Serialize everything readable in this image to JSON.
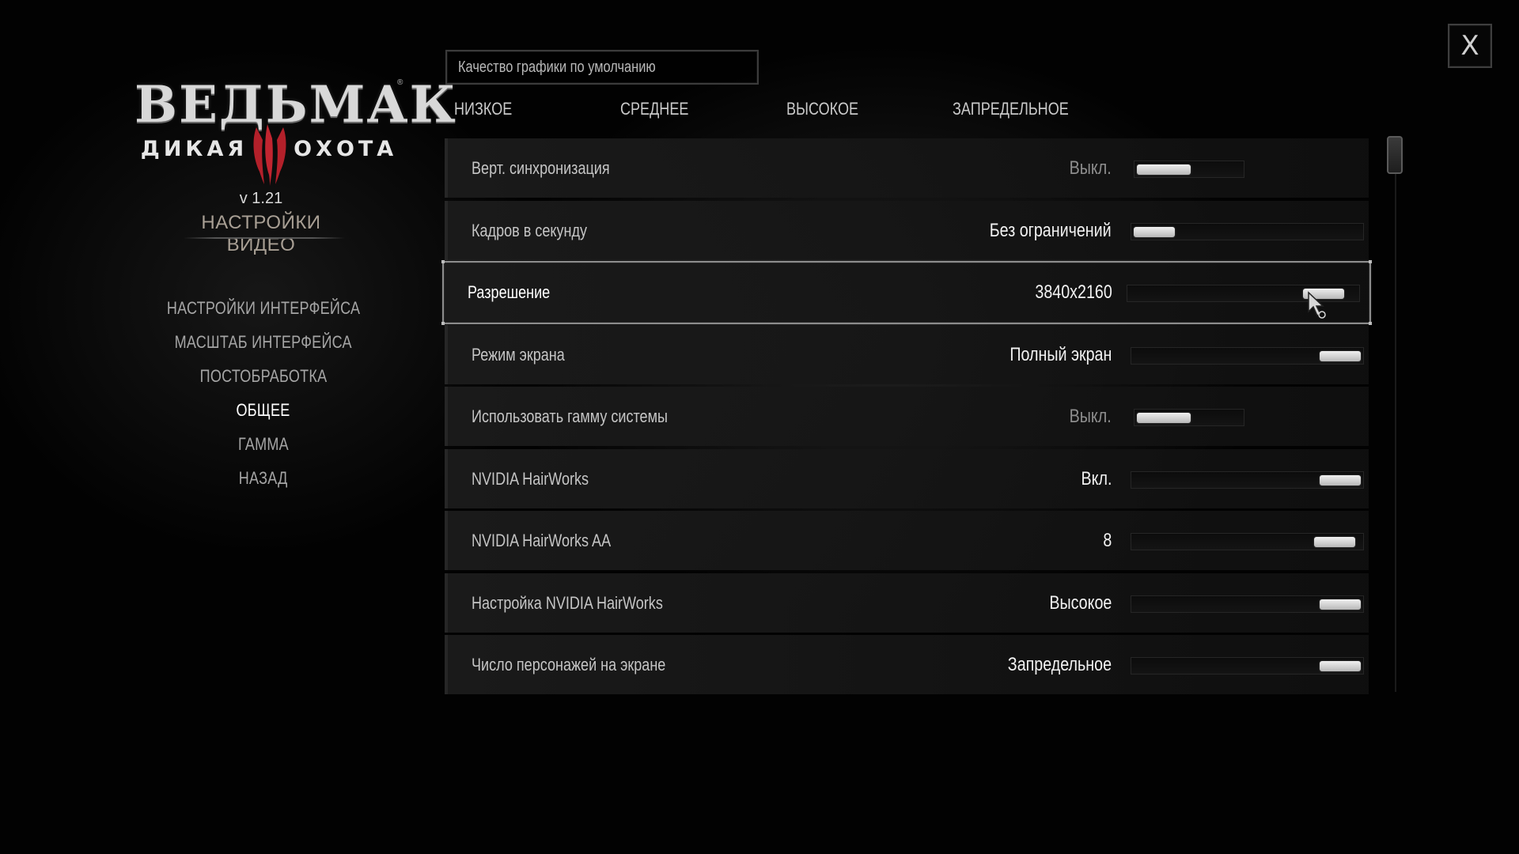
{
  "logo": {
    "title": "ВЕДЬМАК",
    "subtitle_left": "ДИКАЯ",
    "subtitle_right": "ОХОТА",
    "registered_mark": "®",
    "emblem_icon": "wolf-claw-III-icon"
  },
  "version": "v 1.21",
  "section_title": "НАСТРОЙКИ ВИДЕО",
  "menu": {
    "items": [
      {
        "label": "НАСТРОЙКИ ИНТЕРФЕЙСА",
        "active": false
      },
      {
        "label": "МАСШТАБ ИНТЕРФЕЙСА",
        "active": false
      },
      {
        "label": "ПОСТОБРАБОТКА",
        "active": false
      },
      {
        "label": "ОБЩЕЕ",
        "active": true
      },
      {
        "label": "ГАММА",
        "active": false
      },
      {
        "label": "НАЗАД",
        "active": false
      }
    ]
  },
  "preset": {
    "label": "Качество графики по умолчанию",
    "options": [
      "НИЗКОЕ",
      "СРЕДНЕЕ",
      "ВЫСОКОЕ",
      "ЗАПРЕДЕЛЬНОЕ"
    ]
  },
  "settings": [
    {
      "label": "Верт. синхронизация",
      "value": "Выкл.",
      "kind": "toggle",
      "level": 0.0,
      "dim": true,
      "selected": false
    },
    {
      "label": "Кадров в секунду",
      "value": "Без ограничений",
      "kind": "slider",
      "level": 0.0,
      "dim": false,
      "selected": false
    },
    {
      "label": "Разрешение",
      "value": "3840x2160",
      "kind": "slider",
      "level": 0.93,
      "dim": false,
      "selected": true
    },
    {
      "label": "Режим экрана",
      "value": "Полный экран",
      "kind": "slider",
      "level": 1.0,
      "dim": false,
      "selected": false
    },
    {
      "label": "Использовать гамму системы",
      "value": "Выкл.",
      "kind": "toggle",
      "level": 0.0,
      "dim": true,
      "selected": false
    },
    {
      "label": "NVIDIA HairWorks",
      "value": "Вкл.",
      "kind": "slider",
      "level": 1.0,
      "dim": false,
      "selected": false
    },
    {
      "label": "NVIDIA HairWorks AA",
      "value": "8",
      "kind": "slider",
      "level": 0.97,
      "dim": false,
      "selected": false
    },
    {
      "label": "Настройка NVIDIA HairWorks",
      "value": "Высокое",
      "kind": "slider",
      "level": 1.0,
      "dim": false,
      "selected": false
    },
    {
      "label": "Число персонажей на экране",
      "value": "Запредельное",
      "kind": "slider",
      "level": 1.0,
      "dim": false,
      "selected": false
    }
  ],
  "close": {
    "label": "X"
  },
  "colors": {
    "accent_active": "#ffffff",
    "menu_inactive": "#a5a5a5",
    "section_title": "#a89f94",
    "emblem_red": "#b3202a"
  }
}
